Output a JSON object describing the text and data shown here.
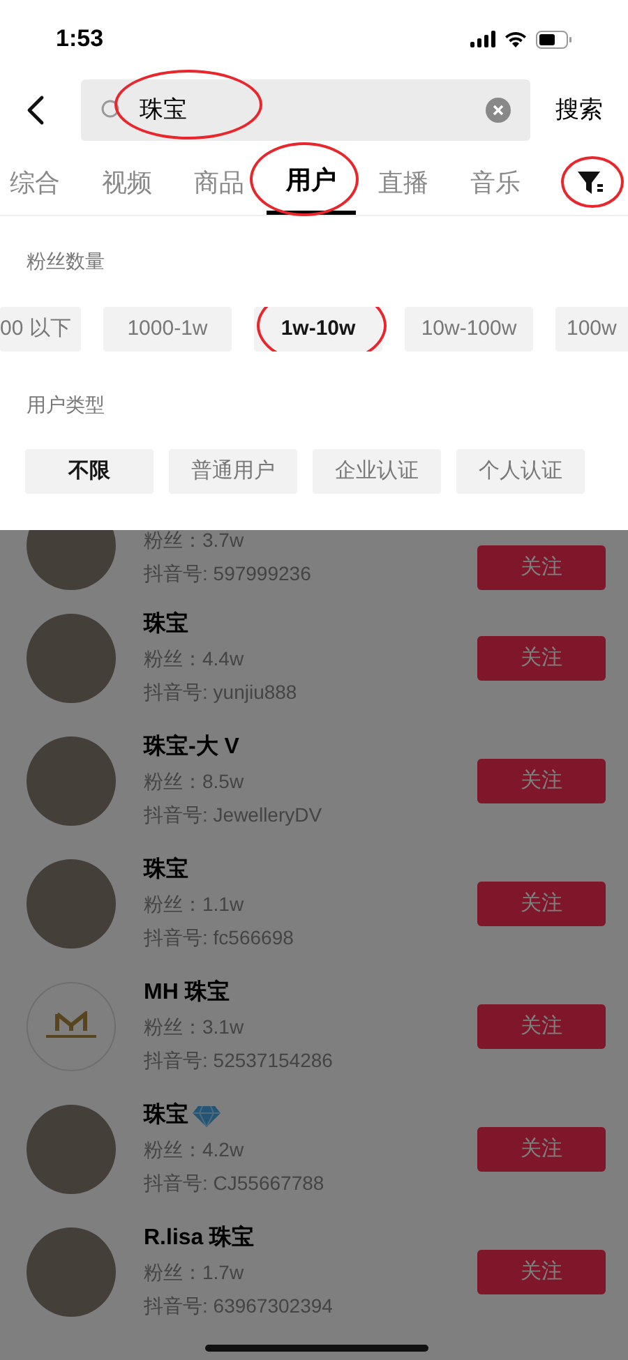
{
  "status_bar": {
    "time": "1:53"
  },
  "search": {
    "query": "珠宝",
    "query_circled": true,
    "submit": "搜索"
  },
  "tabs": [
    {
      "label": "综合",
      "selected": false,
      "circled": false
    },
    {
      "label": "视频",
      "selected": false,
      "circled": false
    },
    {
      "label": "商品",
      "selected": false,
      "circled": false
    },
    {
      "label": "用户",
      "selected": true,
      "circled": true
    },
    {
      "label": "直播",
      "selected": false,
      "circled": false
    },
    {
      "label": "音乐",
      "selected": false,
      "circled": false
    }
  ],
  "filter_button": {
    "circled": true
  },
  "filter_panel": {
    "sections": [
      {
        "title": "粉丝数量",
        "options": [
          {
            "label": "00 以下",
            "selected": false,
            "circled": false
          },
          {
            "label": "1000-1w",
            "selected": false,
            "circled": false
          },
          {
            "label": "1w-10w",
            "selected": true,
            "circled": true
          },
          {
            "label": "10w-100w",
            "selected": false,
            "circled": false
          },
          {
            "label": "100w",
            "selected": false,
            "circled": false
          }
        ]
      },
      {
        "title": "用户类型",
        "options": [
          {
            "label": "不限",
            "selected": true,
            "circled": false
          },
          {
            "label": "普通用户",
            "selected": false,
            "circled": false
          },
          {
            "label": "企业认证",
            "selected": false,
            "circled": false
          },
          {
            "label": "个人认证",
            "selected": false,
            "circled": false
          }
        ]
      }
    ]
  },
  "users": [
    {
      "kind": "photo",
      "fans": "粉丝：3.7w",
      "account": "抖音号: 597999236",
      "follow": "关注"
    },
    {
      "kind": "photo",
      "name": "珠宝",
      "fans": "粉丝：4.4w",
      "account": "抖音号: yunjiu888",
      "follow": "关注"
    },
    {
      "kind": "photo",
      "name": "珠宝-大 V",
      "fans": "粉丝：8.5w",
      "account": "抖音号: JewelleryDV",
      "follow": "关注"
    },
    {
      "kind": "photo",
      "name": "珠宝",
      "fans": "粉丝：1.1w",
      "account": "抖音号: fc566698",
      "follow": "关注"
    },
    {
      "kind": "logo",
      "name": "MH 珠宝",
      "fans": "粉丝：3.1w",
      "account": "抖音号: 52537154286",
      "follow": "关注"
    },
    {
      "kind": "photo",
      "name": "珠宝",
      "badge": {
        "kind": "diamond"
      },
      "fans": "粉丝：4.2w",
      "account": "抖音号: CJ55667788",
      "follow": "关注"
    },
    {
      "kind": "photo",
      "name": "R.lisa 珠宝",
      "fans": "粉丝：1.7w",
      "account": "抖音号: 63967302394",
      "follow": "关注"
    }
  ]
}
